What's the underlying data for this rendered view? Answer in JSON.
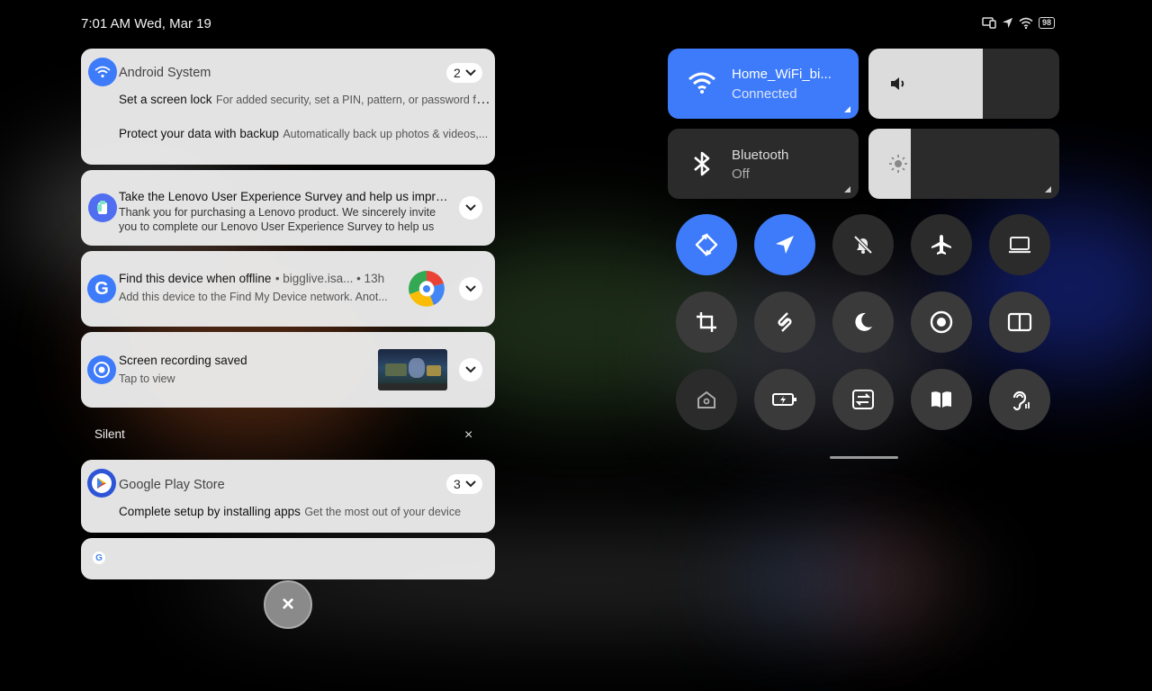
{
  "status_bar": {
    "time_date": "7:01 AM  Wed, Mar 19",
    "battery": "98"
  },
  "notifications": [
    {
      "app": "Android System",
      "count": "2",
      "items": [
        {
          "title": "Set a screen lock",
          "text": "For added security, set a PIN, pattern, or password fo..."
        },
        {
          "title": "Protect your data with backup",
          "text": "Automatically back up photos & videos,..."
        }
      ]
    },
    {
      "title": "Take the Lenovo User Experience Survey and help us improve",
      "text_line1": "Thank you for purchasing a Lenovo product. We sincerely invite",
      "text_line2": "you to complete our Lenovo User Experience Survey to help us"
    },
    {
      "title": "Find this device when offline",
      "meta": "• bigglive.isa... • 13h",
      "text": "Add this device to the Find My Device network. Anot..."
    },
    {
      "title": "Screen recording saved",
      "text": "Tap to view"
    }
  ],
  "silent": {
    "label": "Silent",
    "close": "×"
  },
  "silent_notifications": [
    {
      "app": "Google Play Store",
      "count": "3",
      "title": "Complete setup by installing apps",
      "text": "Get the most out of your device"
    }
  ],
  "dismiss_all": "×",
  "quick_settings": {
    "wifi": {
      "title": "Home_WiFi_bi...",
      "status": "Connected"
    },
    "bluetooth": {
      "title": "Bluetooth",
      "status": "Off"
    },
    "volume_level": 0.6,
    "brightness_level": 0.22,
    "toggles": [
      {
        "name": "auto-rotate",
        "state": "on"
      },
      {
        "name": "location",
        "state": "on"
      },
      {
        "name": "do-not-disturb",
        "state": "off"
      },
      {
        "name": "airplane-mode",
        "state": "off"
      },
      {
        "name": "desktop-mode",
        "state": "off"
      },
      {
        "name": "screenshot-crop",
        "state": "off"
      },
      {
        "name": "share",
        "state": "off"
      },
      {
        "name": "dark-mode",
        "state": "off"
      },
      {
        "name": "screen-record",
        "state": "off"
      },
      {
        "name": "split-screen",
        "state": "off"
      },
      {
        "name": "home-lock",
        "state": "off"
      },
      {
        "name": "battery-saver",
        "state": "off"
      },
      {
        "name": "data-transfer",
        "state": "off"
      },
      {
        "name": "reading-mode",
        "state": "off"
      },
      {
        "name": "hearing-aid",
        "state": "off"
      }
    ]
  },
  "colors": {
    "accent": "#3d7bfa",
    "card_bg": "#ececec",
    "tile_dark": "#2b2b2b"
  }
}
